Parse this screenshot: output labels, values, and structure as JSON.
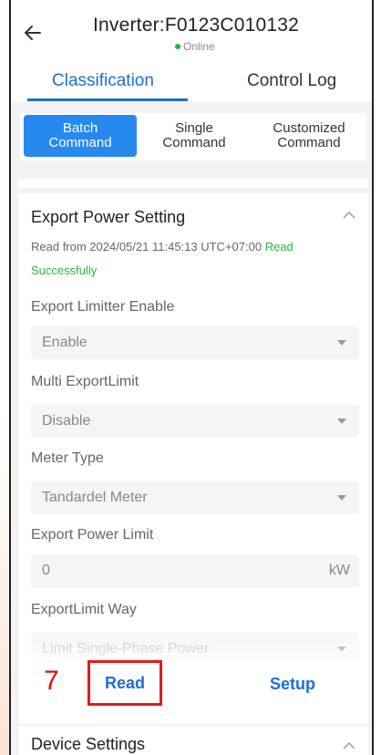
{
  "header": {
    "back_icon": "arrow-left-icon",
    "title": "Inverter:F0123C010132",
    "status": "Online",
    "status_color": "#1fb24a"
  },
  "tabs": [
    {
      "label": "Classification",
      "active": true
    },
    {
      "label": "Control Log",
      "active": false
    }
  ],
  "command_types": [
    {
      "line1": "Batch",
      "line2": "Command",
      "active": true
    },
    {
      "line1": "Single",
      "line2": "Command",
      "active": false
    },
    {
      "line1": "Customized",
      "line2": "Command",
      "active": false
    }
  ],
  "export_section": {
    "title": "Export Power Setting",
    "read_prefix": "Read from 2024/05/21 11:45:13 UTC+07:00",
    "read_status": "Read Successfully",
    "fields": [
      {
        "label": "Export Limitter Enable",
        "value": "Enable",
        "type": "select"
      },
      {
        "label": "Multi ExportLimit",
        "value": "Disable",
        "type": "select"
      },
      {
        "label": "Meter Type",
        "value": "Tandardel Meter",
        "type": "select"
      },
      {
        "label": "Export Power Limit",
        "value": "0",
        "unit": "kW",
        "type": "input"
      },
      {
        "label": "ExportLimit Way",
        "value": "Limit Single-Phase Power",
        "type": "select"
      }
    ]
  },
  "actions": {
    "step_number": "7",
    "read_label": "Read",
    "setup_label": "Setup"
  },
  "device_section": {
    "title": "Device Settings"
  },
  "colors": {
    "accent": "#1b6fd6",
    "active_segment": "#2689f0",
    "highlight": "#e51a1a",
    "success": "#2fb344"
  }
}
